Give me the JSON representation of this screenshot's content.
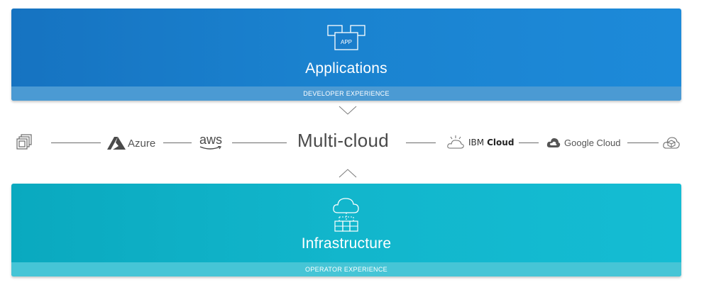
{
  "top_panel": {
    "icon": "app-windows-icon",
    "icon_label": "APP",
    "title": "Applications",
    "footer": "DEVELOPER EXPERIENCE",
    "color": "#1a82cf"
  },
  "bottom_panel": {
    "icon": "cloud-infrastructure-icon",
    "title": "Infrastructure",
    "footer": "OPERATOR EXPERIENCE",
    "color": "#12b6cc"
  },
  "middle_row": {
    "center_label": "Multi-cloud",
    "providers": {
      "left_icon": "vmware-stack-icon",
      "azure": "Azure",
      "aws": "aws",
      "ibm_prefix": "IBM",
      "ibm_suffix": "Cloud",
      "google": "Google Cloud",
      "right_icon": "cube-cloud-icon"
    }
  }
}
